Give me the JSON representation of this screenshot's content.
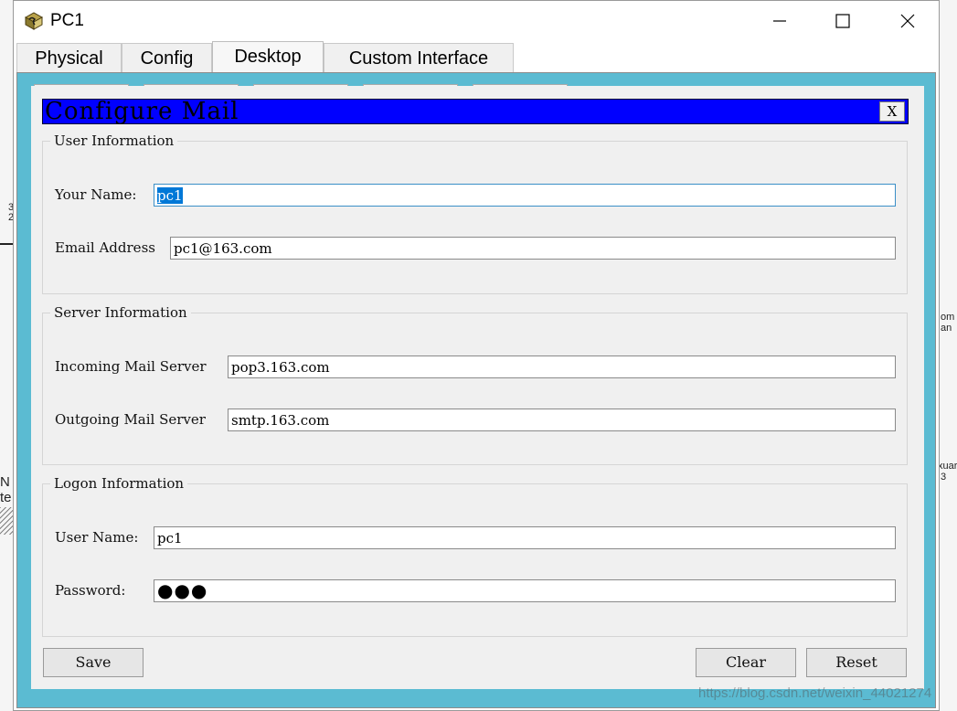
{
  "window": {
    "title": "PC1",
    "app_icon": "packet-tracer-pc-icon",
    "controls": [
      "minimize-icon",
      "maximize-icon",
      "close-icon"
    ]
  },
  "tabs": [
    {
      "label": "Physical",
      "active": false
    },
    {
      "label": "Config",
      "active": false
    },
    {
      "label": "Desktop",
      "active": true
    },
    {
      "label": "Custom Interface",
      "active": false
    }
  ],
  "dialog": {
    "title": "Configure Mail",
    "close_label": "X",
    "title_bar_color": "#0000ff",
    "user_info": {
      "legend": "User Information",
      "name_label": "Your Name:",
      "name_value": "pc1",
      "email_label": "Email Address",
      "email_value": "pc1@163.com"
    },
    "server_info": {
      "legend": "Server Information",
      "incoming_label": "Incoming Mail Server",
      "incoming_value": "pop3.163.com",
      "outgoing_label": "Outgoing Mail Server",
      "outgoing_value": "smtp.163.com"
    },
    "logon_info": {
      "legend": "Logon Information",
      "username_label": "User Name:",
      "username_value": "pc1",
      "password_label": "Password:",
      "password_mask": "●●●"
    },
    "buttons": {
      "save": "Save",
      "clear": "Clear",
      "reset": "Reset"
    }
  },
  "background_fragments": {
    "left_a": "3",
    "left_b": "2",
    "left_c": "N",
    "left_d": "te",
    "right_a": "om",
    "right_b": "an",
    "right_c": "xuar",
    "right_d": "3"
  },
  "watermark": "https://blog.csdn.net/weixin_44021274",
  "colors": {
    "panel_bg": "#5bbbd2",
    "dialog_bg": "#f0f0f0",
    "selection": "#0078d7"
  }
}
